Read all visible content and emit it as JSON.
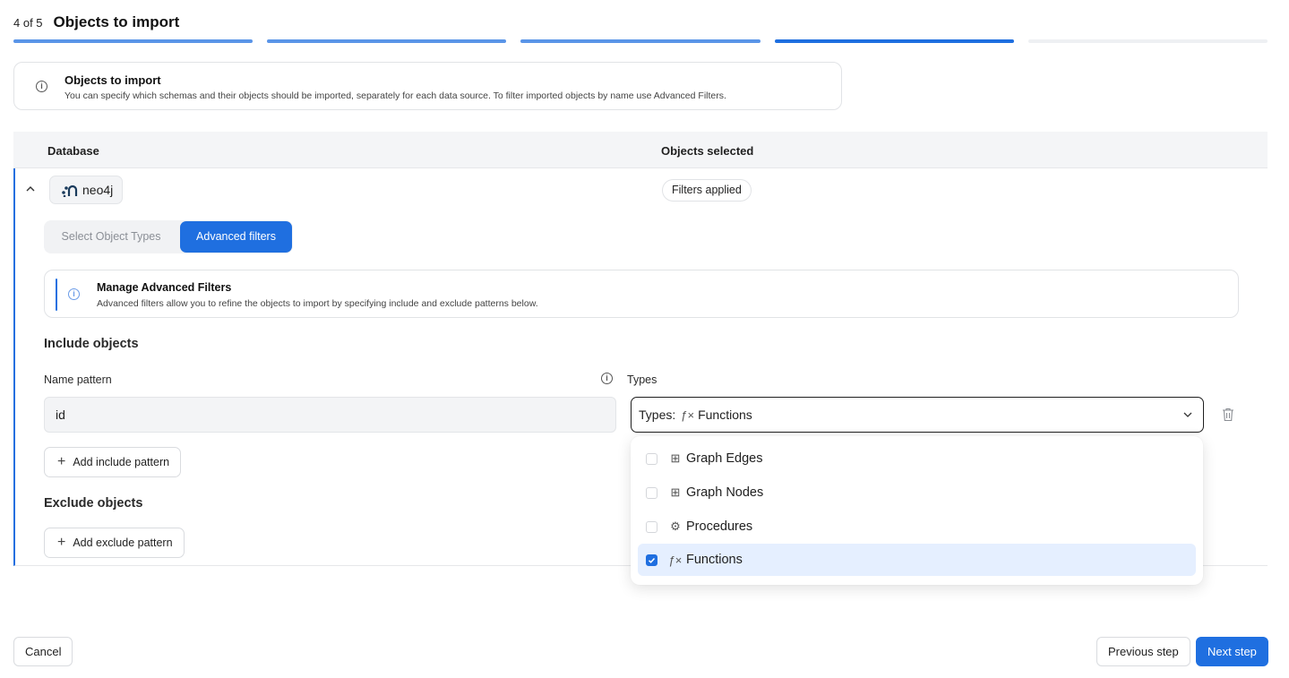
{
  "header": {
    "step_count": "4 of 5",
    "title": "Objects to import"
  },
  "progress": {
    "total_steps": 5,
    "current_step": 4
  },
  "info_box": {
    "title": "Objects to import",
    "description": "You can specify which schemas and their objects should be imported, separately for each data source. To filter imported objects by name use Advanced Filters."
  },
  "table": {
    "col_database": "Database",
    "col_objects": "Objects selected"
  },
  "row": {
    "database_name": "neo4j",
    "objects_status": "Filters applied"
  },
  "tabs": {
    "select_types": "Select Object Types",
    "advanced_filters": "Advanced filters",
    "active": "advanced_filters"
  },
  "manage": {
    "title": "Manage Advanced Filters",
    "description": "Advanced filters allow you to refine the objects to import by specifying include and exclude patterns below."
  },
  "include": {
    "title": "Include objects",
    "name_label": "Name pattern",
    "types_label": "Types",
    "name_value": "id",
    "types_prefix": "Types:",
    "types_icon": "ƒ×",
    "types_value": "Functions",
    "add_button": "Add include pattern"
  },
  "exclude": {
    "title": "Exclude objects",
    "add_button": "Add exclude pattern"
  },
  "dropdown": {
    "options": [
      {
        "label": "Graph Edges",
        "icon": "⊞",
        "icon_name": "graph-edges-icon",
        "checked": false
      },
      {
        "label": "Graph Nodes",
        "icon": "⊞",
        "icon_name": "graph-nodes-icon",
        "checked": false
      },
      {
        "label": "Procedures",
        "icon": "⚙",
        "icon_name": "procedures-icon",
        "checked": false
      },
      {
        "label": "Functions",
        "icon": "ƒ×",
        "icon_name": "functions-icon",
        "checked": true
      }
    ]
  },
  "footer": {
    "cancel": "Cancel",
    "previous": "Previous step",
    "next": "Next step"
  },
  "colors": {
    "accent": "#1f6fe0",
    "progress_done": "#5a95e8",
    "progress_todo": "#eef0f3",
    "selected_bg": "#e5efff"
  }
}
